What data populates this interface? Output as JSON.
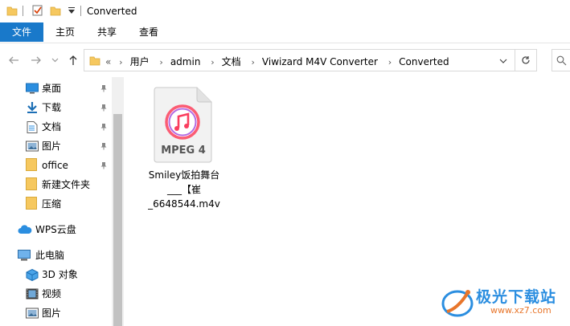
{
  "window": {
    "title": "Converted"
  },
  "ribbon": {
    "tabs": [
      "文件",
      "主页",
      "共享",
      "查看"
    ]
  },
  "address": {
    "chevrons": "«",
    "crumbs": [
      "用户",
      "admin",
      "文档",
      "Viwizard M4V Converter",
      "Converted"
    ],
    "separator": "›"
  },
  "nav": {
    "quick_access": [
      {
        "label": "桌面",
        "icon": "desktop-icon",
        "pinned": true
      },
      {
        "label": "下载",
        "icon": "download-icon",
        "pinned": true
      },
      {
        "label": "文档",
        "icon": "document-icon",
        "pinned": true
      },
      {
        "label": "图片",
        "icon": "picture-icon",
        "pinned": true
      },
      {
        "label": "office",
        "icon": "folder-icon",
        "pinned": true
      },
      {
        "label": "新建文件夹",
        "icon": "folder-icon",
        "pinned": false
      },
      {
        "label": "压缩",
        "icon": "folder-icon",
        "pinned": false
      }
    ],
    "wps": "WPS云盘",
    "this_pc": "此电脑",
    "pc_items": [
      {
        "label": "3D 对象",
        "icon": "3d-objects-icon"
      },
      {
        "label": "视频",
        "icon": "video-icon"
      },
      {
        "label": "图片",
        "icon": "picture-icon"
      }
    ]
  },
  "files": [
    {
      "icon_label": "MPEG 4",
      "name_lines": [
        "Smiley饭拍舞台",
        "___【崔",
        "_6648544.m4v"
      ]
    }
  ],
  "watermark": {
    "text": "极光下载站",
    "url": "www.xz7.com"
  },
  "colors": {
    "accent": "#1979ca",
    "folder": "#f6c85f",
    "watermark_orange": "#e8762b"
  }
}
